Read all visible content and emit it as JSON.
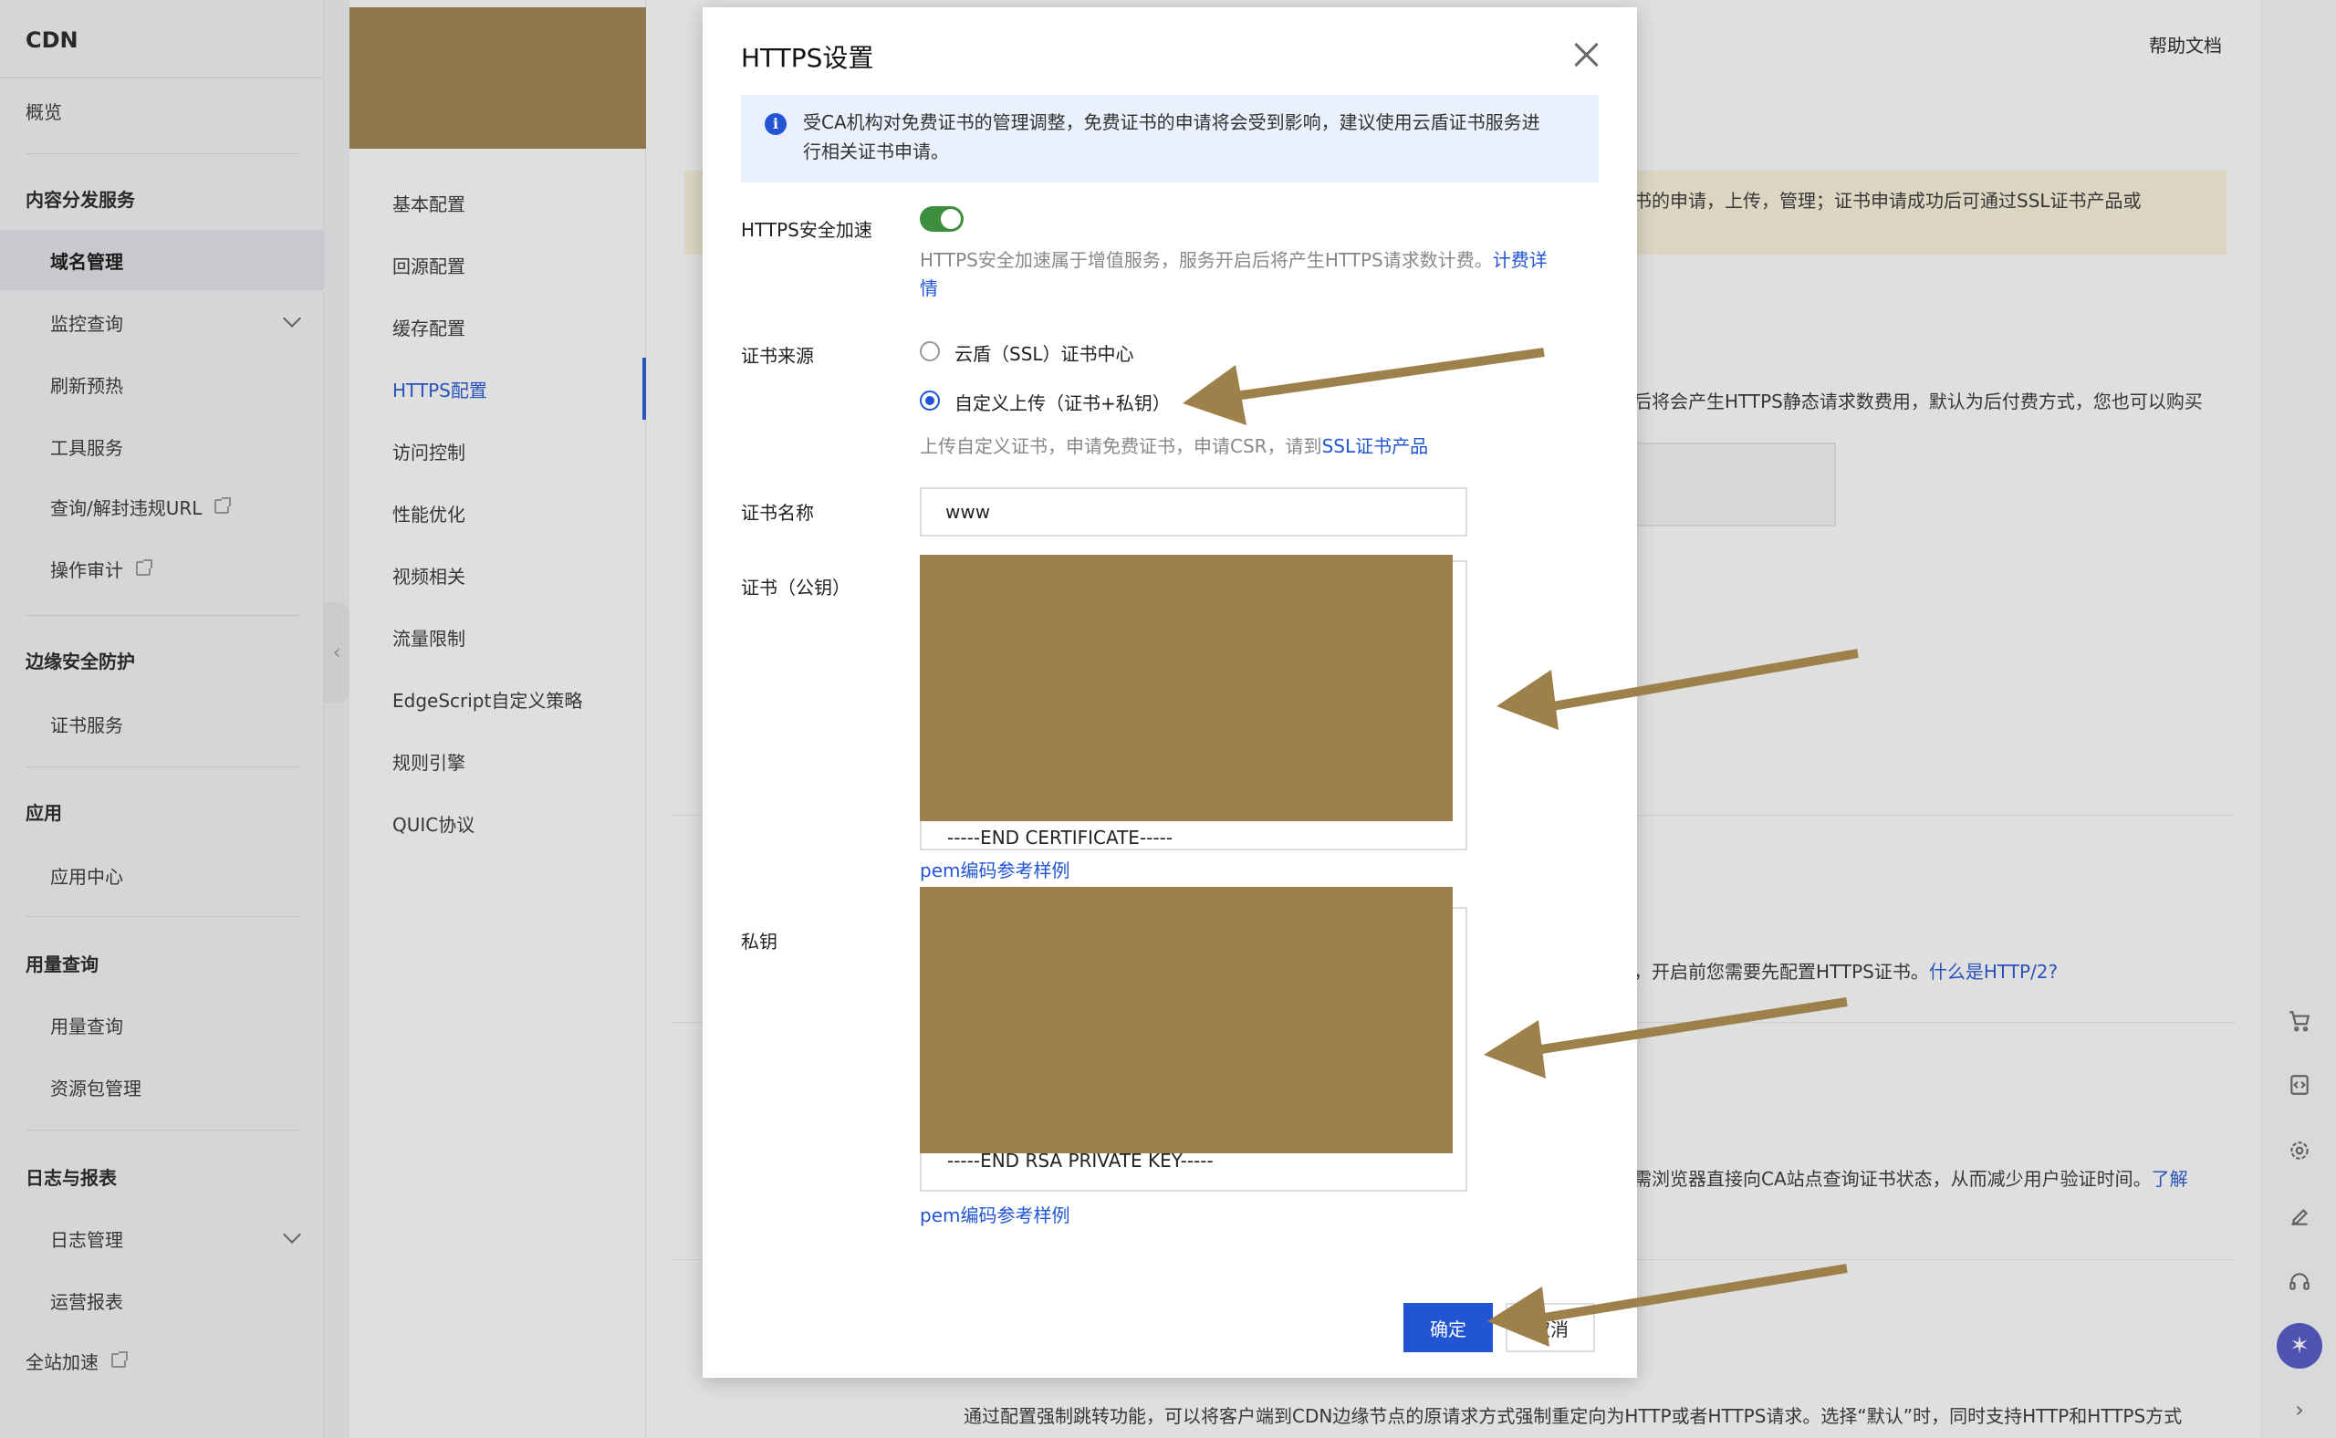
{
  "sidebar": {
    "brand": "CDN",
    "overview": "概览",
    "group_content": "内容分发服务",
    "domain_mgmt": "域名管理",
    "monitor": "监控查询",
    "refresh": "刷新预热",
    "tools": "工具服务",
    "query_url": "查询/解封违规URL",
    "audit": "操作审计",
    "group_edge": "边缘安全防护",
    "cert_service": "证书服务",
    "group_app": "应用",
    "app_center": "应用中心",
    "group_usage": "用量查询",
    "usage_query": "用量查询",
    "pkg_mgmt": "资源包管理",
    "group_logs": "日志与报表",
    "log_mgmt": "日志管理",
    "ops_report": "运营报表",
    "full_accel": "全站加速"
  },
  "subnav": {
    "items": [
      "基本配置",
      "回源配置",
      "缓存配置",
      "HTTPS配置",
      "访问控制",
      "性能优化",
      "视频相关",
      "流量限制",
      "EdgeScript自定义策略",
      "规则引擎",
      "QUIC协议"
    ]
  },
  "main": {
    "help": "帮助文档",
    "warn_text": "书的申请，上传，管理；证书申请成功后可通过SSL证书产品或",
    "bg_line1": "后将会产生HTTPS静态请求数费用，默认为后付费方式，您也可以购买",
    "bg_line2": "，开启前您需要先配置HTTPS证书。",
    "bg_link2": "什么是HTTP/2?",
    "bg_line3": "需浏览器直接向CA站点查询证书状态，从而减少用户验证时间。",
    "bg_link3": "了解",
    "bg_line4": "通过配置强制跳转功能，可以将客户端到CDN边缘节点的原请求方式强制重定向为HTTP或者HTTPS请求。选择“默认”时，同时支持HTTP和HTTPS方式"
  },
  "modal": {
    "title": "HTTPS设置",
    "info": "受CA机构对免费证书的管理调整，免费证书的申请将会受到影响，建议使用云盾证书服务进行相关证书申请。",
    "https_accel_label": "HTTPS安全加速",
    "https_accel_hint": "HTTPS安全加速属于增值服务，服务开启后将产生HTTPS请求数计费。",
    "https_accel_link": "计费详情",
    "cert_source_label": "证书来源",
    "source_opt1": "云盾（SSL）证书中心",
    "source_opt2": "自定义上传（证书+私钥）",
    "upload_hint": "上传自定义证书，申请免费证书，申请CSR，请到",
    "upload_link": "SSL证书产品",
    "cert_name_label": "证书名称",
    "cert_name_value": "www",
    "cert_pub_label": "证书（公钥）",
    "cert_pub_end": "-----END CERTIFICATE-----",
    "pem_link": "pem编码参考样例",
    "private_key_label": "私钥",
    "private_key_end": "-----END RSA PRIVATE KEY-----",
    "ok": "确定",
    "cancel": "取消"
  },
  "colors": {
    "accent": "#2155d4",
    "toggle_on": "#3d8f3e",
    "redaction": "#9e804a",
    "info_bg": "#eaf1fd",
    "warn_bg": "#faf3dc"
  },
  "icons": [
    "info-icon",
    "close-icon",
    "chevron-down-icon",
    "external-link-icon",
    "cart-icon",
    "code-icon",
    "gear-icon",
    "edit-icon",
    "headset-icon",
    "chevron-right-icon"
  ]
}
